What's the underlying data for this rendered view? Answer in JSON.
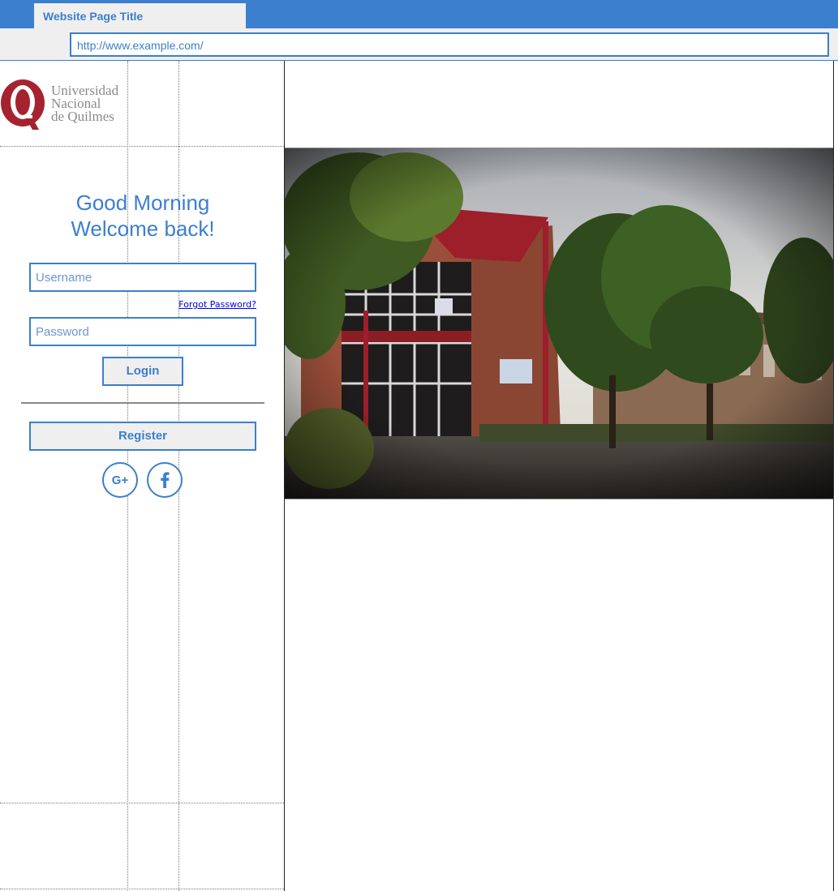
{
  "browser": {
    "tab_title": "Website Page Title",
    "url": "http://www.example.com/"
  },
  "logo": {
    "lines": [
      "Universidad",
      "Nacional",
      "de Quilmes"
    ],
    "letter": "Q",
    "brand_color": "#a5232f"
  },
  "login": {
    "greeting_line1": "Good Morning",
    "greeting_line2": "Welcome back!",
    "username_placeholder": "Username",
    "password_placeholder": "Password",
    "forgot_label": "Forgot Password?",
    "login_label": "Login",
    "register_label": "Register"
  },
  "social": {
    "google_label": "G+",
    "google_icon": "google-plus-icon",
    "facebook_icon": "facebook-icon"
  },
  "hero": {
    "image": "university-building-photo"
  },
  "colors": {
    "accent": "#3b7fce",
    "chrome_bg": "#efefef",
    "link": "#0000ee"
  }
}
